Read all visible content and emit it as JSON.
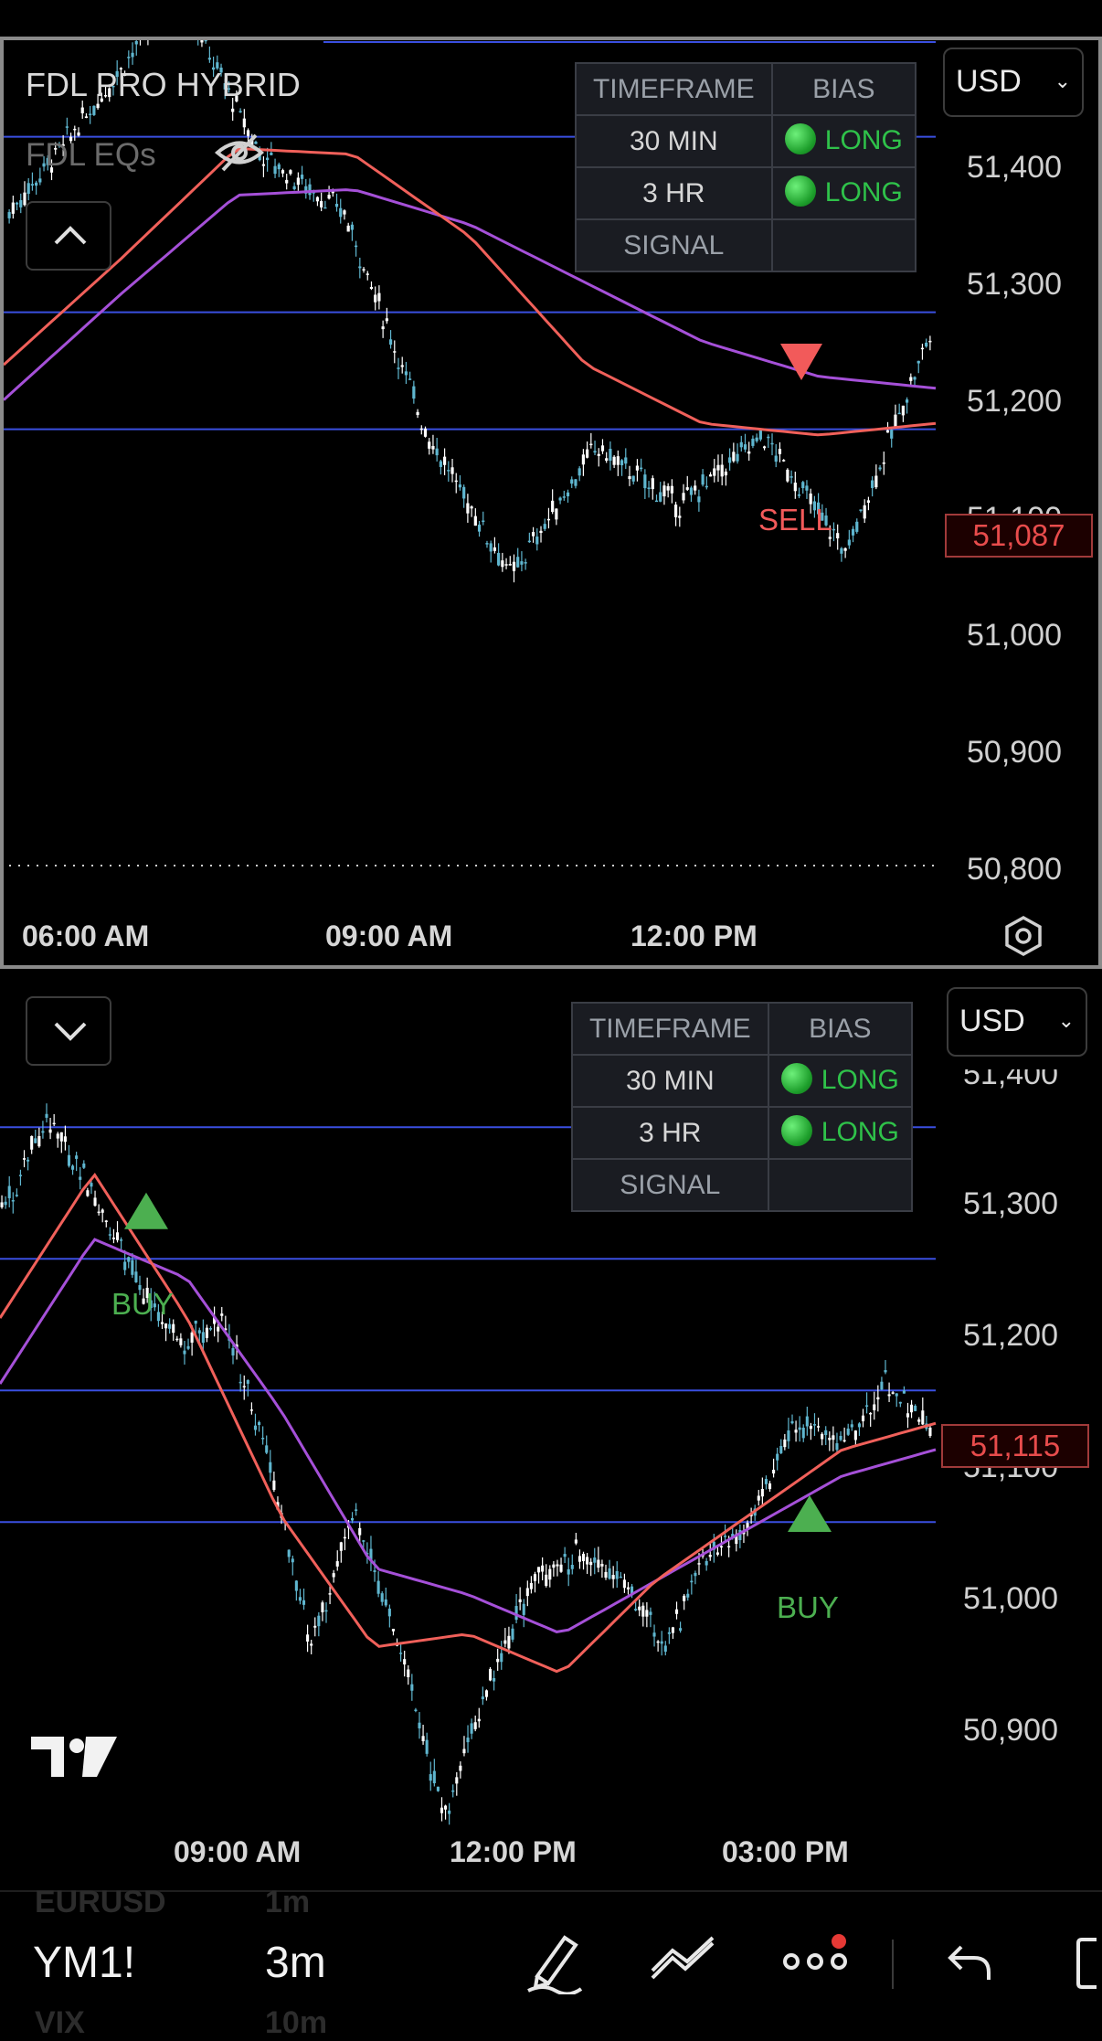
{
  "top_pane": {
    "indicator_title": "FDL PRO HYBRID",
    "indicator_subtitle": "FDL EQs",
    "currency": "USD",
    "bias_table": {
      "headers": [
        "TIMEFRAME",
        "BIAS"
      ],
      "rows": [
        {
          "timeframe": "30 MIN",
          "bias": "LONG"
        },
        {
          "timeframe": "3 HR",
          "bias": "LONG"
        },
        {
          "timeframe": "SIGNAL",
          "bias": ""
        }
      ]
    },
    "price_axis": [
      "51,400",
      "51,300",
      "51,200",
      "51,100",
      "51,000",
      "50,900",
      "50,800"
    ],
    "last_price": "51,087",
    "signal_label": "SELL",
    "time_axis": [
      "06:00 AM",
      "09:00 AM",
      "12:00 PM"
    ],
    "settings_icon": "hexagon-settings-icon"
  },
  "bottom_pane": {
    "currency": "USD",
    "bias_table": {
      "headers": [
        "TIMEFRAME",
        "BIAS"
      ],
      "rows": [
        {
          "timeframe": "30 MIN",
          "bias": "LONG"
        },
        {
          "timeframe": "3 HR",
          "bias": "LONG"
        },
        {
          "timeframe": "SIGNAL",
          "bias": ""
        }
      ]
    },
    "price_axis": [
      "51,400",
      "51,300",
      "51,200",
      "51,100",
      "51,000",
      "50,900"
    ],
    "last_price": "51,115",
    "signal_labels": [
      "BUY",
      "BUY"
    ],
    "time_axis": [
      "09:00 AM",
      "12:00 PM",
      "03:00 PM"
    ]
  },
  "bottom_bar": {
    "symbol": "YM1!",
    "interval": "3m",
    "ghost_items": [
      {
        "symbol": "EURUSD",
        "interval": "1m"
      },
      {
        "symbol": "VIX",
        "interval": "10m"
      }
    ],
    "tools": [
      "pencil-icon",
      "trend-line-icon",
      "more-icon",
      "undo-icon",
      "fullscreen-icon"
    ]
  },
  "colors": {
    "candle": "#5fb6cf",
    "level_line": "#3a4fe0",
    "ma_fast": "#f0605a",
    "ma_slow": "#a550d8",
    "sell": "#f25a5a",
    "buy": "#4caf50"
  },
  "chart_data": [
    {
      "type": "line",
      "title": "",
      "x": [
        "06:00 AM",
        "09:00 AM",
        "12:00 PM"
      ],
      "ylim": [
        50800,
        51400
      ],
      "series": [
        {
          "values": [
            51190,
            51280,
            51380,
            51240,
            51190,
            51000,
            50880,
            50990,
            50940,
            51000,
            50900,
            51087
          ]
        },
        {
          "values": [
            51060,
            51150,
            51245,
            51240,
            51170,
            51060,
            51010,
            51000,
            51010
          ]
        },
        {
          "values": [
            51030,
            51120,
            51205,
            51210,
            51180,
            51130,
            51080,
            51050,
            51040
          ]
        }
      ],
      "annotations": [
        {
          "label": "SELL",
          "value": 51050
        }
      ]
    },
    {
      "type": "line",
      "title": "",
      "x": [
        "09:00 AM",
        "12:00 PM",
        "03:00 PM"
      ],
      "ylim": [
        50800,
        51400
      ],
      "series": [
        {
          "values": [
            51280,
            51350,
            51300,
            51230,
            51180,
            51200,
            51100,
            50950,
            51050,
            50950,
            50820,
            50920,
            51000,
            51020,
            51000,
            50950,
            51020,
            51050,
            51120,
            51100,
            51150,
            51115
          ]
        },
        {
          "values": [
            51200,
            51310,
            51200,
            51050,
            50950,
            50960,
            50930,
            51000,
            51050,
            51100,
            51120
          ]
        },
        {
          "values": [
            51150,
            51260,
            51230,
            51130,
            51010,
            50990,
            50960,
            51000,
            51040,
            51080,
            51100
          ]
        }
      ],
      "annotations": [
        {
          "label": "BUY",
          "value": 51280
        },
        {
          "label": "BUY",
          "value": 51050
        }
      ]
    }
  ]
}
